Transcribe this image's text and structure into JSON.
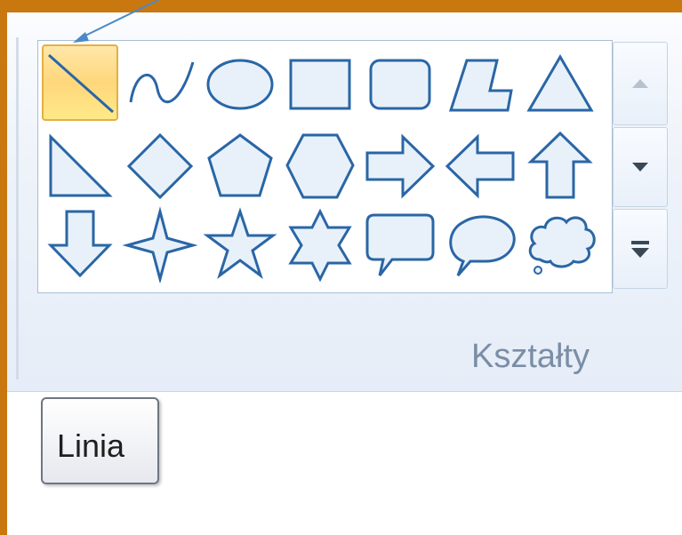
{
  "ribbon": {
    "group_label": "Kształty",
    "shapes": [
      {
        "name": "line-shape-icon",
        "selected": true
      },
      {
        "name": "curve-shape-icon"
      },
      {
        "name": "oval-shape-icon"
      },
      {
        "name": "rectangle-shape-icon"
      },
      {
        "name": "rounded-rectangle-shape-icon"
      },
      {
        "name": "polygon-shape-icon"
      },
      {
        "name": "triangle-shape-icon"
      },
      {
        "name": "right-triangle-shape-icon"
      },
      {
        "name": "diamond-shape-icon"
      },
      {
        "name": "pentagon-shape-icon"
      },
      {
        "name": "hexagon-shape-icon"
      },
      {
        "name": "right-arrow-shape-icon"
      },
      {
        "name": "left-arrow-shape-icon"
      },
      {
        "name": "up-arrow-shape-icon"
      },
      {
        "name": "down-arrow-shape-icon"
      },
      {
        "name": "four-point-star-shape-icon"
      },
      {
        "name": "five-point-star-shape-icon"
      },
      {
        "name": "six-point-star-shape-icon"
      },
      {
        "name": "rounded-rectangle-callout-shape-icon"
      },
      {
        "name": "oval-callout-shape-icon"
      },
      {
        "name": "cloud-callout-shape-icon"
      }
    ],
    "scroll": {
      "up_icon": "scroll-up-icon",
      "down_icon": "scroll-down-icon",
      "expand_icon": "gallery-expand-icon"
    }
  },
  "tooltip": {
    "text": "Linia"
  },
  "colors": {
    "frame": "#c8780e",
    "shape_stroke": "#2a66a6",
    "shape_fill": "#e8f1fa",
    "selected_fill": "#ffd77a",
    "pointer": "#4a8ac8"
  }
}
